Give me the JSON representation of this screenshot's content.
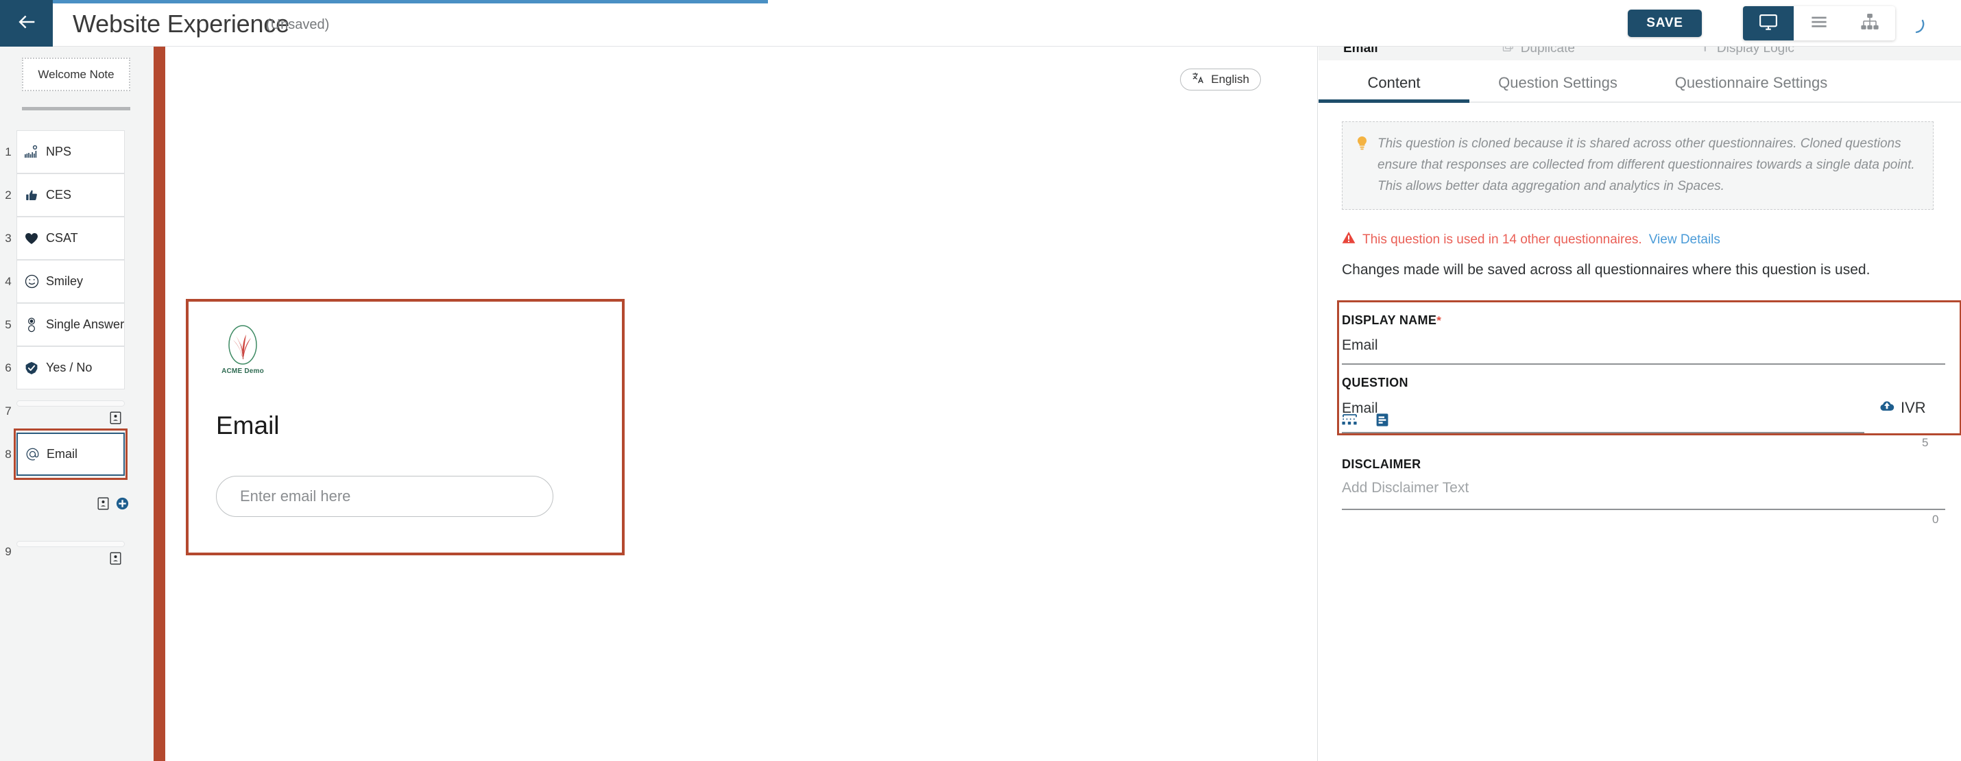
{
  "header": {
    "back_icon": "arrow-left-icon",
    "title": "Website Experience",
    "subtitle": "(Unsaved)",
    "save_label": "SAVE",
    "view_desktop_icon": "monitor-icon",
    "view_list_icon": "hamburger-menu-icon",
    "view_tree_icon": "sitemap-icon",
    "loading_icon": "spinner-icon",
    "accent_color": "#4a90c4",
    "brand_color": "#1e4d6b"
  },
  "sidebar": {
    "welcome_note_label": "Welcome Note",
    "divider_color": "#b4492f",
    "items": [
      {
        "num": "1",
        "label": "NPS",
        "icon": "bar-chart-nps-icon",
        "selected": false,
        "empty": false
      },
      {
        "num": "2",
        "label": "CES",
        "icon": "thumbs-up-icon",
        "selected": false,
        "empty": false
      },
      {
        "num": "3",
        "label": "CSAT",
        "icon": "heart-icon",
        "selected": false,
        "empty": false
      },
      {
        "num": "4",
        "label": "Smiley",
        "icon": "smiley-face-icon",
        "selected": false,
        "empty": false
      },
      {
        "num": "5",
        "label": "Single Answer",
        "icon": "radio-button-icon",
        "selected": false,
        "empty": false
      },
      {
        "num": "6",
        "label": "Yes / No",
        "icon": "check-badge-icon",
        "selected": false,
        "empty": false
      },
      {
        "num": "7",
        "label": "",
        "icon": "",
        "selected": false,
        "empty": true
      },
      {
        "num": "8",
        "label": "Email",
        "icon": "at-sign-icon",
        "selected": true,
        "empty": false
      },
      {
        "num": "9",
        "label": "",
        "icon": "",
        "selected": false,
        "empty": true
      }
    ],
    "row_action_icons": {
      "card_icon": "contact-card-icon",
      "add_icon": "add-circle-icon"
    }
  },
  "canvas": {
    "language_label": "English",
    "language_icon": "translate-icon",
    "logo_caption": "ACME Demo",
    "question_title": "Email",
    "input_placeholder": "Enter email here"
  },
  "right_panel": {
    "cutoff_row": {
      "item1_label": "Email",
      "item2_label": "Duplicate",
      "item2_icon": "duplicate-icon",
      "item3_label": "Display Logic",
      "item3_icon": "display-logic-icon"
    },
    "tabs": [
      {
        "label": "Content",
        "active": true
      },
      {
        "label": "Question Settings",
        "active": false
      },
      {
        "label": "Questionnaire Settings",
        "active": false
      }
    ],
    "info_notice": {
      "icon": "lightbulb-icon",
      "text": "This question is cloned because it is shared across other questionnaires. Cloned questions ensure that responses are collected from different questionnaires towards a single data point. This allows better data aggregation and analytics in Spaces."
    },
    "warning": {
      "icon": "warning-triangle-icon",
      "text": "This question is used in 14 other questionnaires.",
      "link_label": "View Details",
      "color": "#ea5f56",
      "link_color": "#4a9bd8"
    },
    "notice_text": "Changes made will be saved across all questionnaires where this question is used.",
    "fields": {
      "display_name": {
        "label": "DISPLAY NAME",
        "required_marker": "*",
        "value": "Email"
      },
      "question": {
        "label": "QUESTION",
        "value": "Email",
        "char_count": "5",
        "ivr_label": "IVR",
        "ivr_icon": "cloud-upload-icon"
      },
      "disclaimer": {
        "label": "DISCLAIMER",
        "placeholder": "Add Disclaimer Text",
        "char_count": "0"
      }
    },
    "tool_icons": [
      {
        "name": "pipe-variable-icon"
      },
      {
        "name": "text-format-icon"
      }
    ],
    "highlight_color": "#b4492f"
  }
}
